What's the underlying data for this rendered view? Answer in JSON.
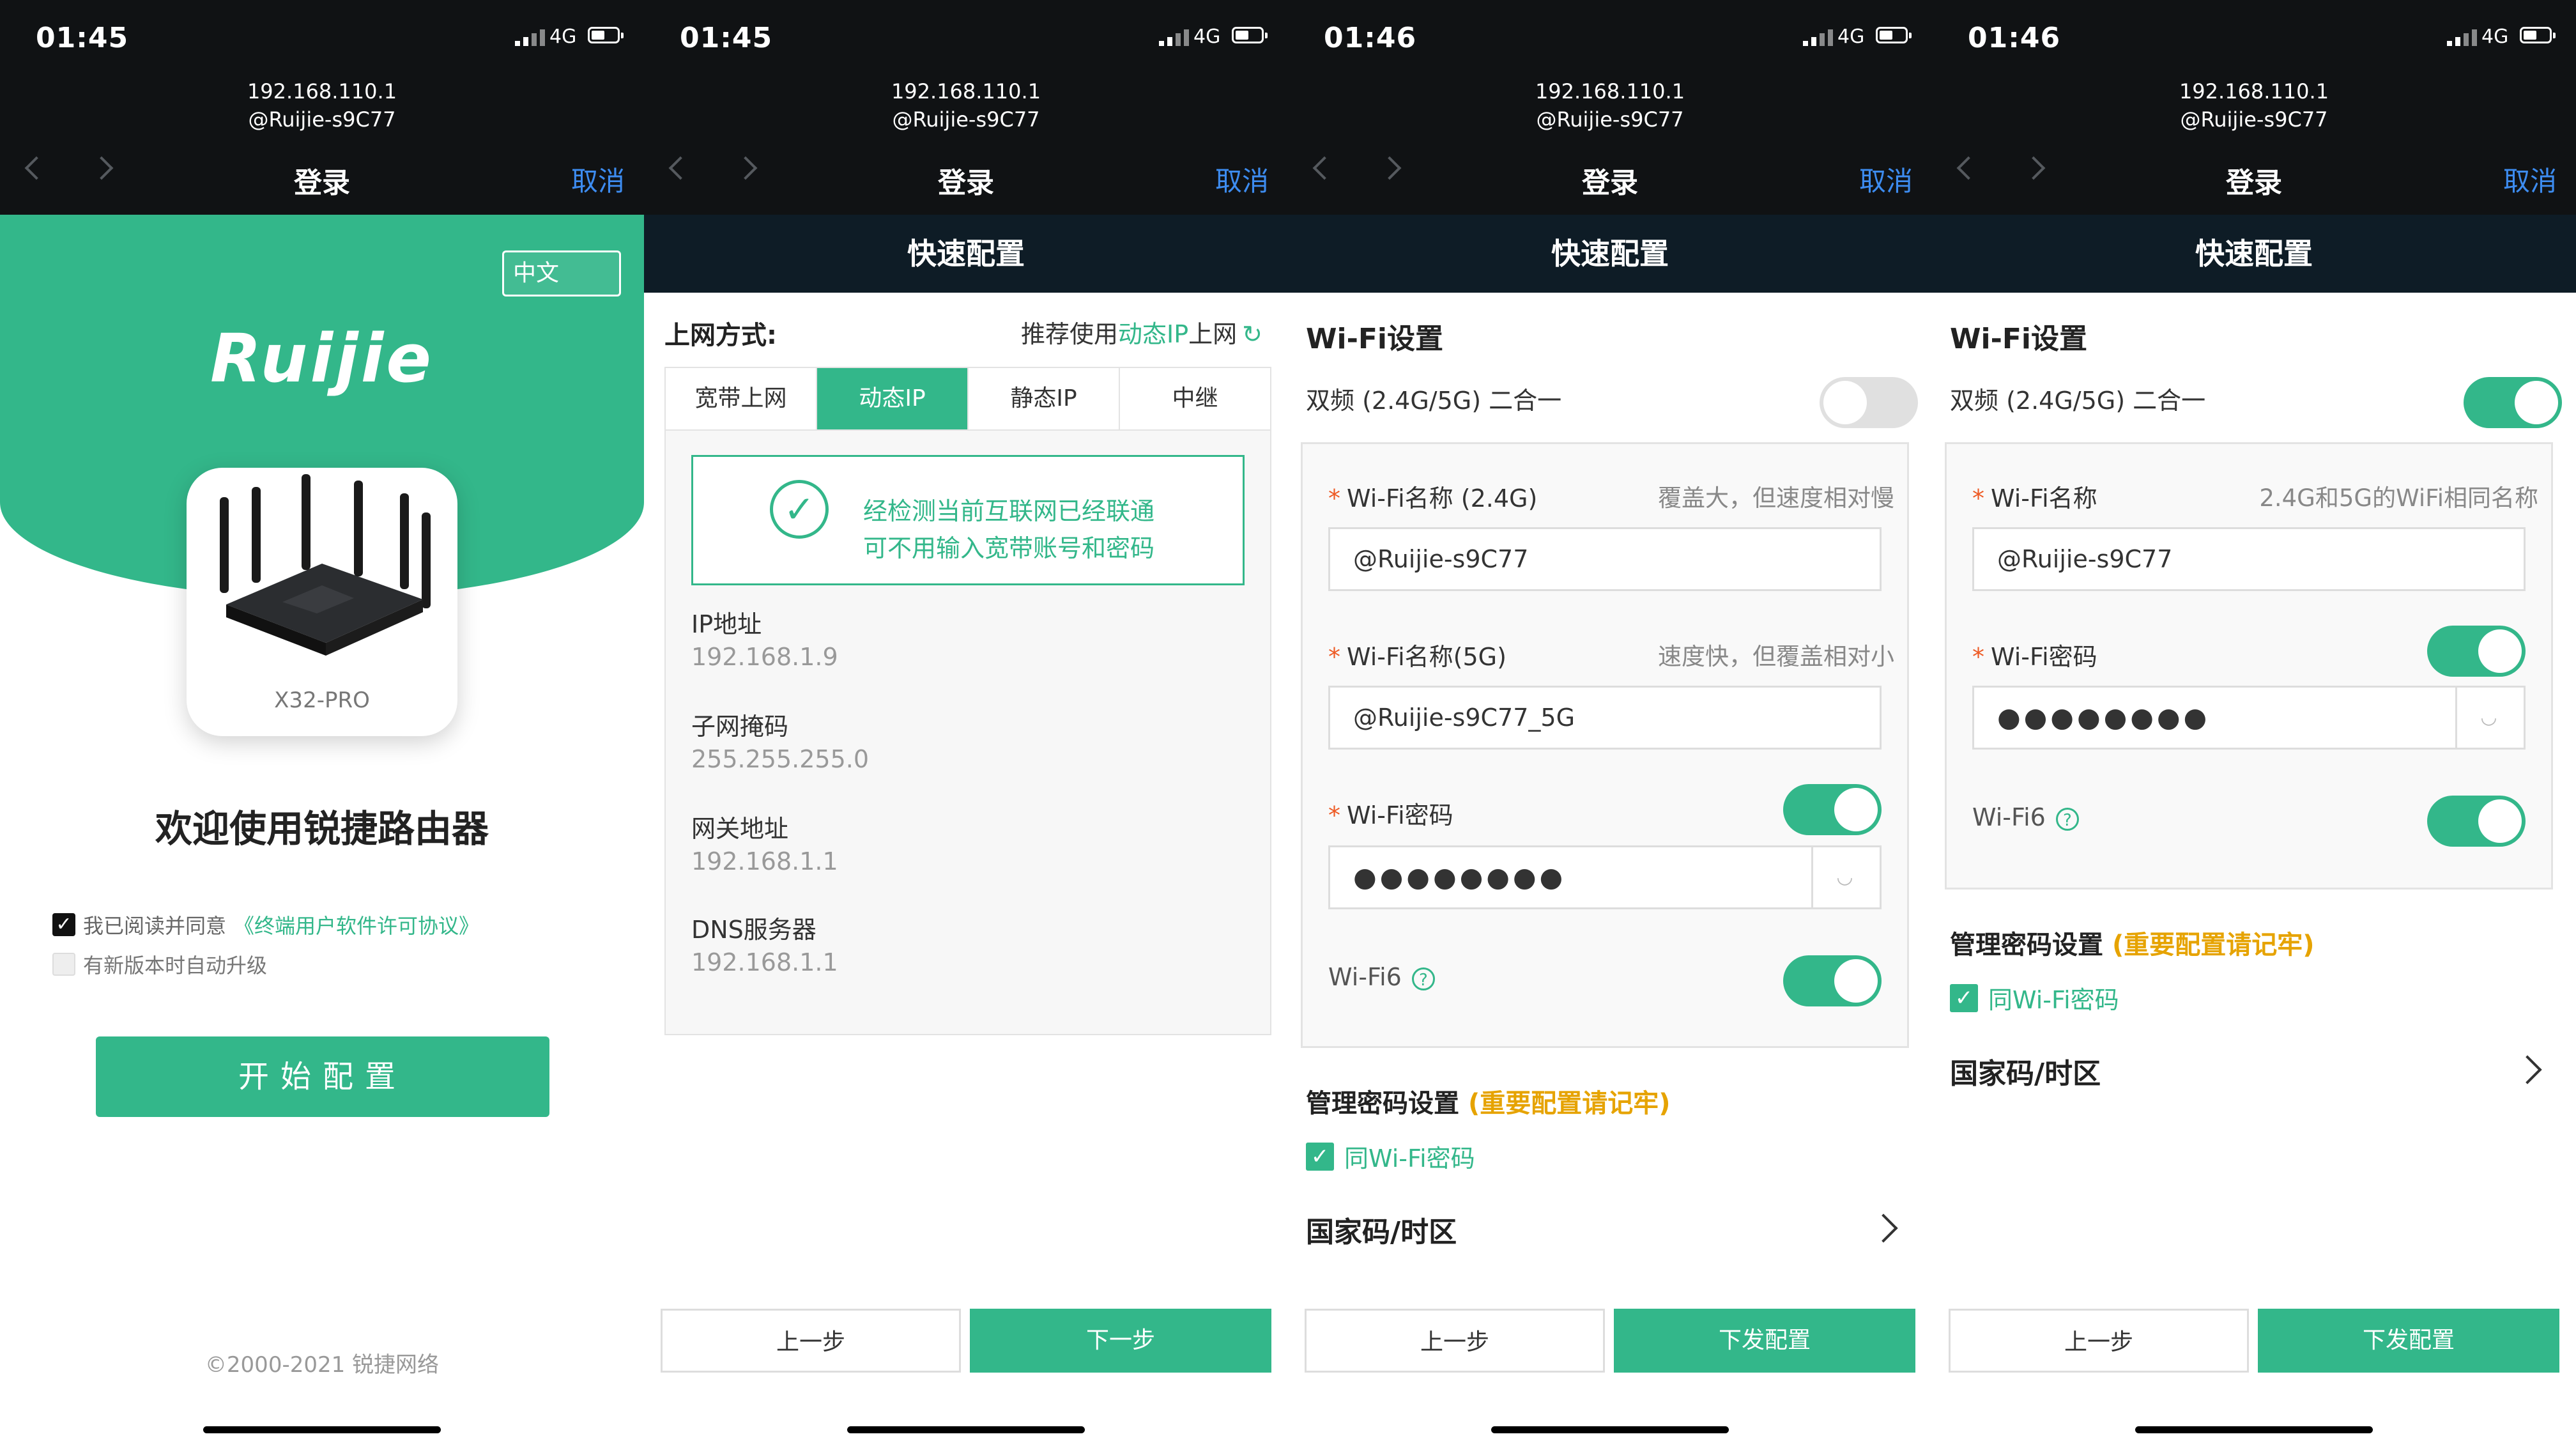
{
  "colors": {
    "accent": "#33b78a",
    "status_bar": "#101214",
    "header": "#0e1c26",
    "link": "#3d8cf0",
    "warning": "#e6a300"
  },
  "screens": [
    {
      "time": "01:45",
      "network": "4G",
      "url1": "192.168.110.1",
      "url2": "@Ruijie-s9C77",
      "nav_title": "登录",
      "cancel": "取消",
      "lang": "中文",
      "logo": "Ruijie",
      "model": "X32-PRO",
      "welcome": "欢迎使用锐捷路由器",
      "agree_text": "我已阅读并同意",
      "agree_link": "《终端用户软件许可协议》",
      "agree_checked": true,
      "auto_upgrade": "有新版本时自动升级",
      "auto_checked": false,
      "start_button": "开始配置",
      "copyright": "©2000-2021 锐捷网络"
    },
    {
      "time": "01:45",
      "network": "4G",
      "url1": "192.168.110.1",
      "url2": "@Ruijie-s9C77",
      "nav_title": "登录",
      "cancel": "取消",
      "header": "快速配置",
      "mode_label": "上网方式:",
      "recommend_pre": "推荐使用",
      "recommend_link": "动态IP",
      "recommend_post": "上网",
      "tabs": [
        "宽带上网",
        "动态IP",
        "静态IP",
        "中继"
      ],
      "active_tab": 1,
      "status_line1": "经检测当前互联网已经联通",
      "status_line2": "可不用输入宽带账号和密码",
      "fields": [
        {
          "label": "IP地址",
          "value": "192.168.1.9"
        },
        {
          "label": "子网掩码",
          "value": "255.255.255.0"
        },
        {
          "label": "网关地址",
          "value": "192.168.1.1"
        },
        {
          "label": "DNS服务器",
          "value": "192.168.1.1"
        }
      ],
      "prev_button": "上一步",
      "next_button": "下一步"
    },
    {
      "time": "01:46",
      "network": "4G",
      "url1": "192.168.110.1",
      "url2": "@Ruijie-s9C77",
      "nav_title": "登录",
      "cancel": "取消",
      "header": "快速配置",
      "section": "Wi-Fi设置",
      "dual_band": "双频 (2.4G/5G) 二合一",
      "dual_on": false,
      "ssid24_label": "Wi-Fi名称 (2.4G)",
      "ssid24_hint": "覆盖大，但速度相对慢",
      "ssid24_value": "@Ruijie-s9C77",
      "ssid5_label": "Wi-Fi名称(5G)",
      "ssid5_hint": "速度快，但覆盖相对小",
      "ssid5_value": "@Ruijie-s9C77_5G",
      "pwd_label": "Wi-Fi密码",
      "pwd_on": true,
      "pwd_value": "●●●●●●●●",
      "wifi6": "Wi-Fi6",
      "wifi6_on": true,
      "mgmt_label": "管理密码设置",
      "mgmt_warn": "(重要配置请记牢)",
      "same_label": "同Wi-Fi密码",
      "same_checked": true,
      "country": "国家码/时区",
      "prev_button": "上一步",
      "next_button": "下发配置"
    },
    {
      "time": "01:46",
      "network": "4G",
      "url1": "192.168.110.1",
      "url2": "@Ruijie-s9C77",
      "nav_title": "登录",
      "cancel": "取消",
      "header": "快速配置",
      "section": "Wi-Fi设置",
      "dual_band": "双频 (2.4G/5G) 二合一",
      "dual_on": true,
      "ssid_label": "Wi-Fi名称",
      "ssid_hint": "2.4G和5G的WiFi相同名称",
      "ssid_value": "@Ruijie-s9C77",
      "pwd_label": "Wi-Fi密码",
      "pwd_on": true,
      "pwd_value": "●●●●●●●●",
      "wifi6": "Wi-Fi6",
      "wifi6_on": true,
      "mgmt_label": "管理密码设置",
      "mgmt_warn": "(重要配置请记牢)",
      "same_label": "同Wi-Fi密码",
      "same_checked": true,
      "country": "国家码/时区",
      "prev_button": "上一步",
      "next_button": "下发配置"
    }
  ]
}
